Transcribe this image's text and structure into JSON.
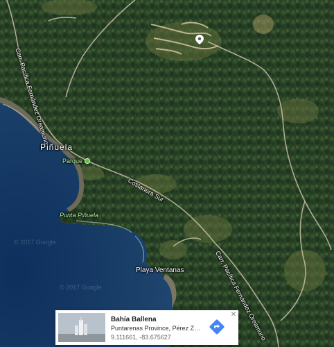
{
  "map": {
    "labels": {
      "road_northwest": "Carr. Pacífica Fernández Oreamuno",
      "punuela_town": "Piñuela",
      "parque": "Parque",
      "costanera": "Costanera Sur",
      "punta_punuela": "Punta Piñuela",
      "playa_ventanas": "Playa Ventanas",
      "road_southeast": "Carr. Pacífica Fernández Oreamuno",
      "watermark_1": "© 2017 Google",
      "watermark_2": "© 2017 Google"
    },
    "icons": {
      "pin": "map-pin-icon",
      "park": "park-poi-icon"
    }
  },
  "info_card": {
    "title": "Bahía Ballena",
    "subtitle": "Puntarenas Province, Pérez Zeled...",
    "coordinates": "9.111661, -83.675627",
    "directions_icon": "directions-icon",
    "close_label": "✕",
    "accent_color": "#4285f4"
  }
}
